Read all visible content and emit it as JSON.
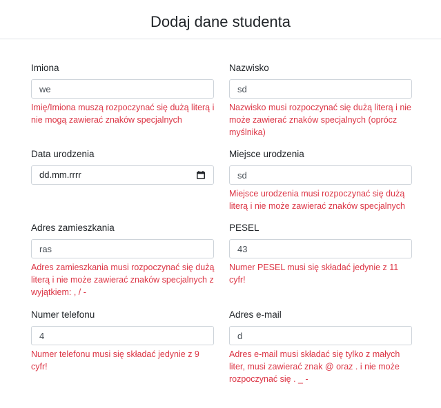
{
  "header": {
    "title": "Dodaj dane studenta"
  },
  "form": {
    "imiona": {
      "label": "Imiona",
      "value": "we",
      "error": "Imię/Imiona muszą rozpoczynać się dużą literą i nie mogą zawierać znaków specjalnych"
    },
    "nazwisko": {
      "label": "Nazwisko",
      "value": "sd",
      "error": "Nazwisko musi rozpoczynać się dużą literą i nie może zawierać znaków specjalnych (oprócz myślnika)"
    },
    "data_urodzenia": {
      "label": "Data urodzenia",
      "placeholder": "dd.mm.rrrr",
      "icon": "calendar-icon"
    },
    "miejsce_urodzenia": {
      "label": "Miejsce urodzenia",
      "value": "sd",
      "error": "Miejsce urodzenia musi rozpoczynać się dużą literą i nie może zawierać znaków specjalnych"
    },
    "adres_zamieszkania": {
      "label": "Adres zamieszkania",
      "value": "ras",
      "error": "Adres zamieszkania musi rozpoczynać się dużą literą i nie może zawierać znaków specjalnych z wyjątkiem: , / -"
    },
    "pesel": {
      "label": "PESEL",
      "value": "43",
      "error": "Numer PESEL musi się składać jedynie z 11 cyfr!"
    },
    "numer_telefonu": {
      "label": "Numer telefonu",
      "value": "4",
      "error": "Numer telefonu musi się składać jedynie z 9 cyfr!"
    },
    "adres_email": {
      "label": "Adres e-mail",
      "value": "d",
      "error": "Adres e-mail musi składać się tylko z małych liter, musi zawierać znak @ oraz . i nie może rozpoczynać się . _ -"
    }
  },
  "colors": {
    "error": "#dc3545",
    "border": "#ced4da",
    "divider": "#dee2e6"
  }
}
